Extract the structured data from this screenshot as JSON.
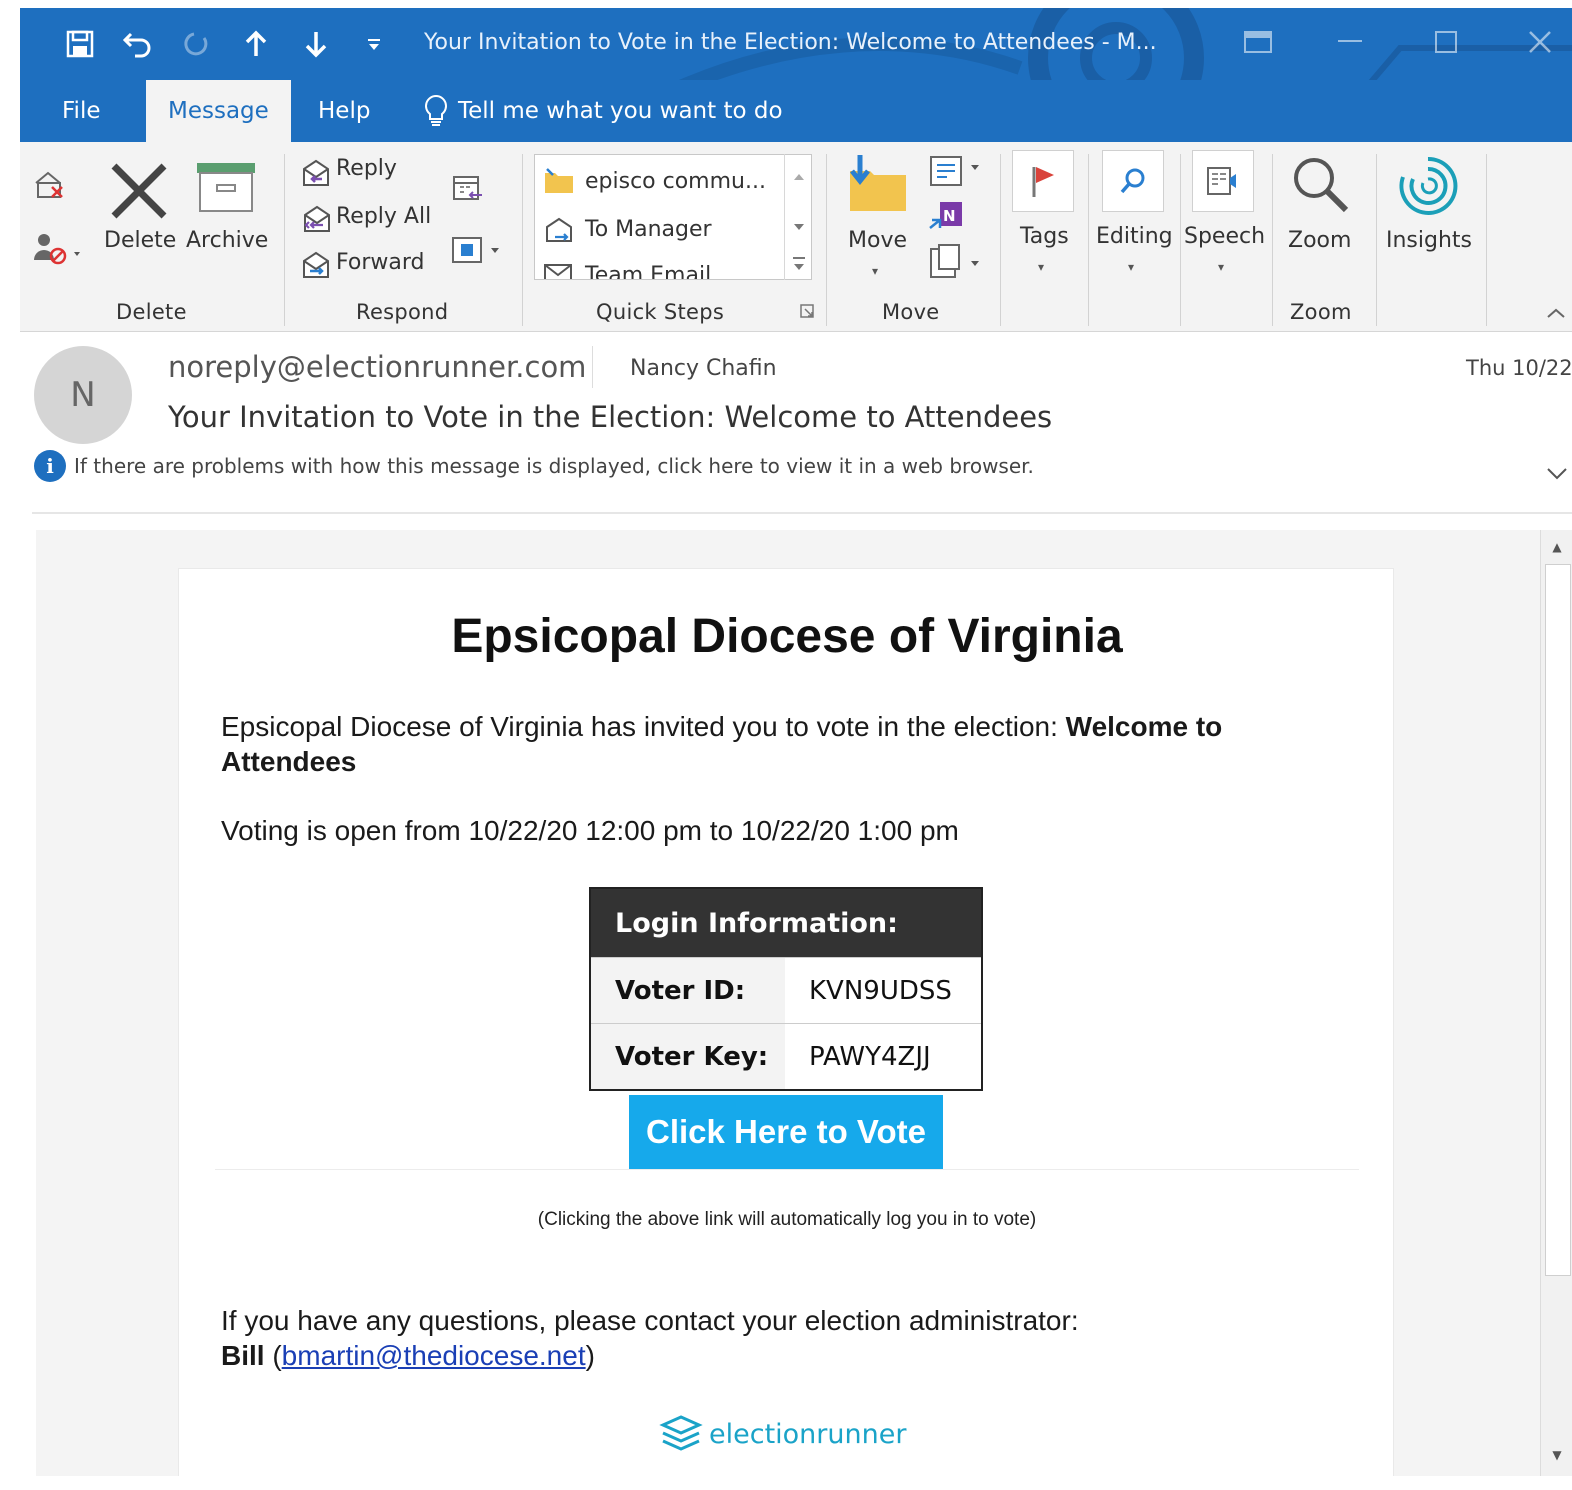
{
  "window": {
    "title": "Your Invitation to Vote in the Election: Welcome to Attendees  -  M..."
  },
  "colors": {
    "accent": "#1e6fbf",
    "vote_button": "#16a9eb",
    "table_header": "#333333",
    "link": "#1a3fb5"
  },
  "tabs": [
    "File",
    "Message",
    "Help"
  ],
  "tell_me": "Tell me what you want to do",
  "ribbon": {
    "delete_group": {
      "label": "Delete",
      "delete": "Delete",
      "archive": "Archive"
    },
    "respond_group": {
      "label": "Respond",
      "reply": "Reply",
      "reply_all": "Reply All",
      "forward": "Forward"
    },
    "quick_steps": {
      "label": "Quick Steps",
      "items": [
        "episco commu...",
        "To Manager",
        "Team Email"
      ]
    },
    "move_group": {
      "label": "Move",
      "move": "Move"
    },
    "tags": "Tags",
    "editing": "Editing",
    "speech": "Speech",
    "zoom_group": {
      "label": "Zoom",
      "zoom": "Zoom"
    },
    "insights": "Insights"
  },
  "message": {
    "avatar_initial": "N",
    "sender": "noreply@electionrunner.com",
    "recipient": "Nancy Chafin",
    "date": "Thu 10/22",
    "subject": "Your Invitation to Vote in the Election: Welcome to Attendees",
    "info": "If there are problems with how this message is displayed, click here to view it in a web browser."
  },
  "email": {
    "org_title": "Epsicopal Diocese of Virginia",
    "invite_text": "Epsicopal Diocese of Virginia has invited you to vote in the election: ",
    "election_name": "Welcome to Attendees",
    "voting_window": "Voting is open from 10/22/20 12:00 pm to 10/22/20 1:00 pm",
    "login_header": "Login Information:",
    "voter_id_label": "Voter ID:",
    "voter_id": "KVN9UDSS",
    "voter_key_label": "Voter Key:",
    "voter_key": "PAWY4ZJJ",
    "vote_button": "Click Here to Vote",
    "fine_print": "(Clicking the above link will automatically log you in to vote)",
    "contact_text": "If you have any questions, please contact your election administrator:",
    "contact_name": "Bill",
    "contact_email": "bmartin@thediocese.net",
    "brand": "electionrunner"
  }
}
